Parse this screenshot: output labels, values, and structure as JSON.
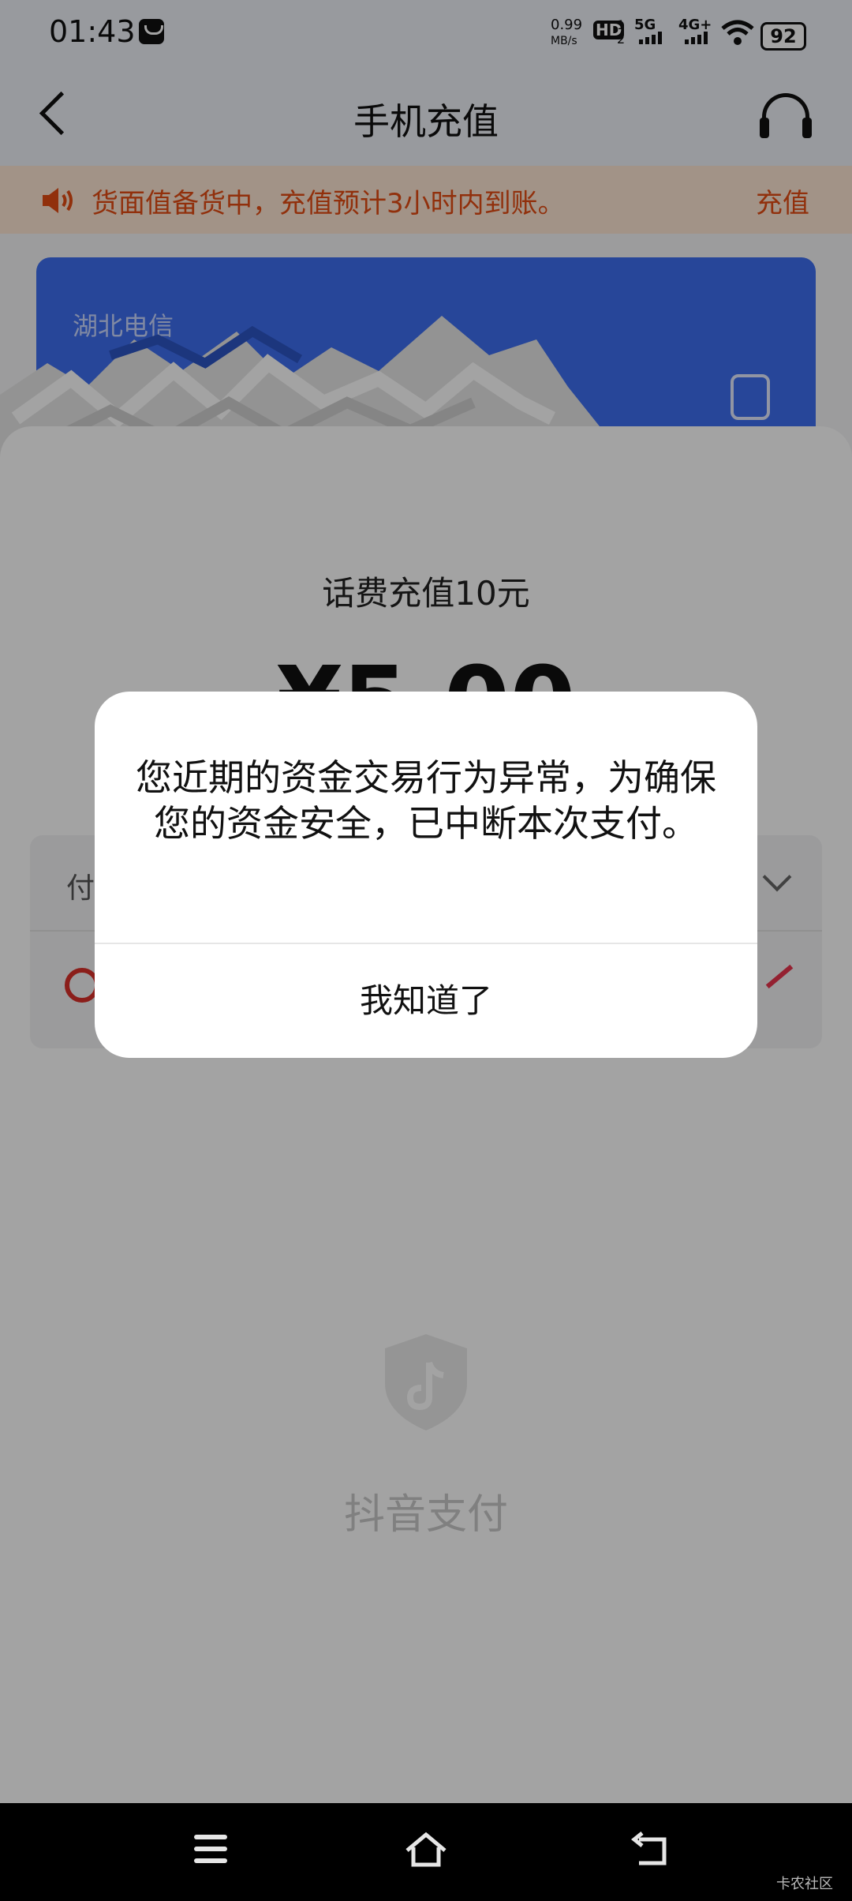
{
  "status_bar": {
    "time": "01:43",
    "speed_value": "0.99",
    "speed_unit": "MB/s",
    "hd_badge": "HD",
    "sim1": "1",
    "sim2": "2",
    "network1": "5G",
    "network2": "4G+",
    "battery": "92"
  },
  "header": {
    "title": "手机充值"
  },
  "notice": {
    "text": "货面值备货中，充值预计3小时内到账。",
    "trailing_text": "充值"
  },
  "card": {
    "label": "湖北电信"
  },
  "payment_sheet": {
    "title": "话费充值10元",
    "price": "¥5.00",
    "pay_method_label": "付"
  },
  "dialog": {
    "message": "您近期的资金交易行为异常，为确保您的资金安全，已中断本次支付。",
    "confirm_label": "我知道了"
  },
  "brand": {
    "name": "抖音支付"
  },
  "watermark": "卡农社区",
  "icons": [
    "back-icon",
    "headset-icon",
    "speaker-icon",
    "contact-icon",
    "bank-icon",
    "edit-icon",
    "shield-icon",
    "menu-icon",
    "home-icon",
    "return-icon"
  ],
  "colors": {
    "notice_text": "#e34c13",
    "card_blue": "#3d6ef0",
    "overlay": "rgba(0,0,0,0.36)"
  }
}
